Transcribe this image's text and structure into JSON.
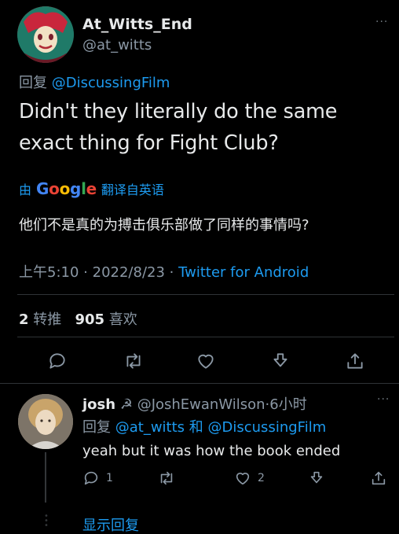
{
  "main_tweet": {
    "display_name": "At_Witts_End",
    "handle": "@at_witts",
    "more": "···",
    "replying_prefix": "回复",
    "replying_to": "@DiscussingFilm",
    "text": "Didn't they literally do the same exact thing for Fight Club?",
    "translate": {
      "by": "由",
      "google_letters": [
        "G",
        "o",
        "o",
        "g",
        "l",
        "e"
      ],
      "suffix": "翻译自英语"
    },
    "translated_text": "他们不是真的为搏击俱乐部做了同样的事情吗?",
    "time": "上午5:10",
    "separator": "·",
    "date": "2022/8/23",
    "client": "Twitter for Android",
    "retweets_count": "2",
    "retweets_label": "转推",
    "likes_count": "905",
    "likes_label": "喜欢",
    "icons": [
      "reply-icon",
      "retweet-icon",
      "like-icon",
      "download-icon",
      "share-icon"
    ]
  },
  "reply_tweet": {
    "display_name": "josh",
    "emoji": "☭",
    "handle": "@JoshEwanWilson",
    "separator": "·",
    "age": "6小时",
    "more": "···",
    "replying_prefix": "回复",
    "replying_to_1": "@at_witts",
    "conjunction": "和",
    "replying_to_2": "@DiscussingFilm",
    "text": "yeah but it was how the book ended",
    "reply_count": "1",
    "like_count": "2",
    "show_replies": "显示回复"
  },
  "colors": {
    "background": "#000000",
    "text": "#e7e9ea",
    "secondary": "#8b98a5",
    "accent": "#1d9bf0",
    "divider": "#2f3336"
  }
}
